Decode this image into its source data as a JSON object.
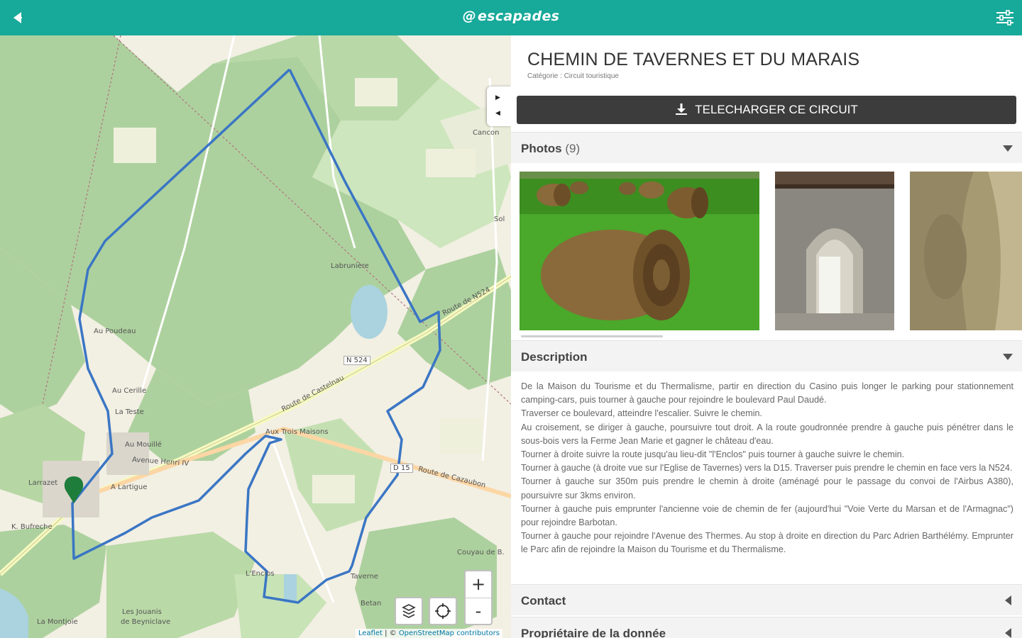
{
  "app": {
    "logo_text": "escapades",
    "back_icon": "back-arrow-icon",
    "filter_icon": "sliders-icon",
    "brand_color": "#17a99a"
  },
  "map": {
    "places": [
      "Cancon",
      "Labrunière",
      "Au Poudeau",
      "Au Cerille",
      "La Teste",
      "Au Mouillé",
      "A Lartigue",
      "Aux Trois Maisons",
      "Larrazet",
      "K. Bufreche",
      "Couyau de B.",
      "Taverne",
      "L'Enclos",
      "Les Jouanis",
      "La Montjoie",
      "Betan",
      "de Beyniclave",
      "Sol"
    ],
    "roads": [
      "N 524",
      "D 15"
    ],
    "road_names": [
      "Route de Castelnau",
      "Route de Cazaubon",
      "Avenue Henri IV",
      "Route de N524"
    ],
    "zoom_in": "+",
    "zoom_out": "-",
    "layers_icon": "layers-icon",
    "locate_icon": "crosshair-icon",
    "attribution_leaflet": "Leaflet",
    "attribution_sep": " | © ",
    "attribution_osm": "OpenStreetMap contributors",
    "route_color": "#3a76c4",
    "marker_color": "#1e7d3a"
  },
  "panel": {
    "title": "CHEMIN DE TAVERNES ET DU MARAIS",
    "subtitle": "Catégorie : Circuit touristique",
    "download_label": "TELECHARGER CE CIRCUIT",
    "download_icon": "download-icon",
    "photos_label": "Photos",
    "photos_count": "(9)",
    "description_label": "Description",
    "description": [
      "De la Maison du Tourisme et du Thermalisme, partir en direction du Casino puis longer le parking pour stationnement camping-cars, puis tourner à gauche pour rejoindre le boulevard Paul Daudé.",
      "Traverser ce boulevard, atteindre l'escalier. Suivre le chemin.",
      "Au croisement, se diriger à gauche, poursuivre tout droit. A la route goudronnée prendre à gauche puis pénétrer dans le sous-bois vers la Ferme Jean Marie et gagner le château d'eau.",
      "Tourner à droite suivre la route jusqu'au lieu-dit \"l'Enclos\" puis tourner à gauche suivre le chemin.",
      "Tourner à gauche (à droite vue sur l'Eglise de Tavernes) vers la D15. Traverser puis prendre le chemin en face vers la N524.",
      "Tourner à gauche sur 350m puis prendre le chemin à droite (aménagé pour le passage du convoi de l'Airbus A380), poursuivre sur 3kms environ.",
      "Tourner à gauche puis emprunter l'ancienne voie de chemin de fer (aujourd'hui \"Voie Verte du Marsan et de l'Armagnac\") pour rejoindre Barbotan.",
      "Tourner à gauche pour rejoindre l'Avenue des Thermes. Au stop à droite en direction du Parc Adrien Barthélémy. Emprunter le Parc afin de rejoindre la Maison du Tourisme et du Thermalisme."
    ],
    "contact_label": "Contact",
    "owner_label": "Propriétaire de la donnée"
  }
}
